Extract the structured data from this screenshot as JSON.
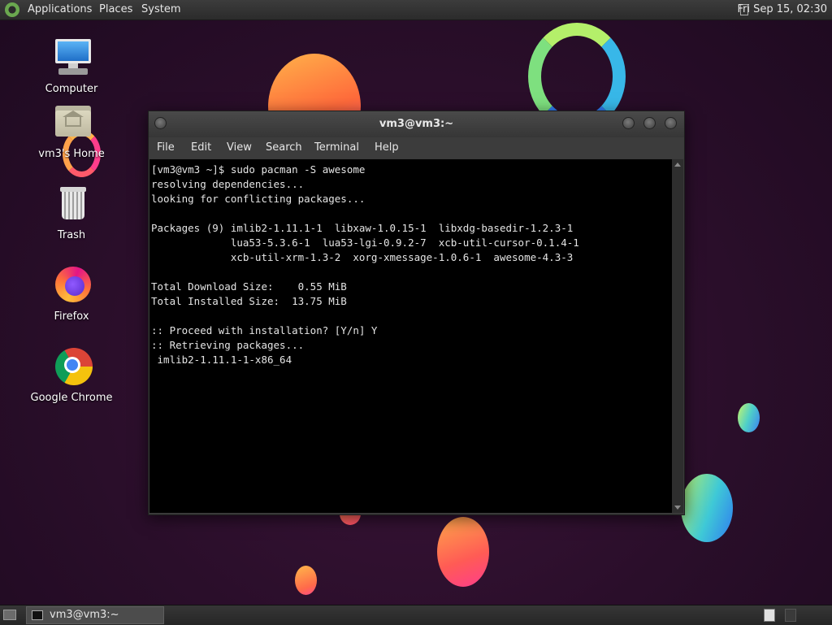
{
  "top_panel": {
    "menus": [
      "Applications",
      "Places",
      "System"
    ],
    "clock": "Fri Sep 15, 02:30"
  },
  "desktop_icons": [
    {
      "label": "Computer",
      "icon": "computer-icon"
    },
    {
      "label": "vm3's Home",
      "icon": "home-folder-icon"
    },
    {
      "label": "Trash",
      "icon": "trash-icon"
    },
    {
      "label": "Firefox",
      "icon": "firefox-icon"
    },
    {
      "label": "Google Chrome",
      "icon": "chrome-icon"
    }
  ],
  "terminal": {
    "title": "vm3@vm3:~",
    "menu": [
      "File",
      "Edit",
      "View",
      "Search",
      "Terminal",
      "Help"
    ],
    "lines": [
      "[vm3@vm3 ~]$ sudo pacman -S awesome",
      "resolving dependencies...",
      "looking for conflicting packages...",
      "",
      "Packages (9) imlib2-1.11.1-1  libxaw-1.0.15-1  libxdg-basedir-1.2.3-1",
      "             lua53-5.3.6-1  lua53-lgi-0.9.2-7  xcb-util-cursor-0.1.4-1",
      "             xcb-util-xrm-1.3-2  xorg-xmessage-1.0.6-1  awesome-4.3-3",
      "",
      "Total Download Size:    0.55 MiB",
      "Total Installed Size:  13.75 MiB",
      "",
      ":: Proceed with installation? [Y/n] Y",
      ":: Retrieving packages...",
      " imlib2-1.11.1-1-x86_64"
    ]
  },
  "bottom_panel": {
    "task_label": "vm3@vm3:~"
  },
  "colors": {
    "desktop_bg": "#2a0f2c",
    "panel_bg": "#2b2b2b",
    "terminal_bg": "#000000",
    "terminal_fg": "#e4e4e4"
  }
}
